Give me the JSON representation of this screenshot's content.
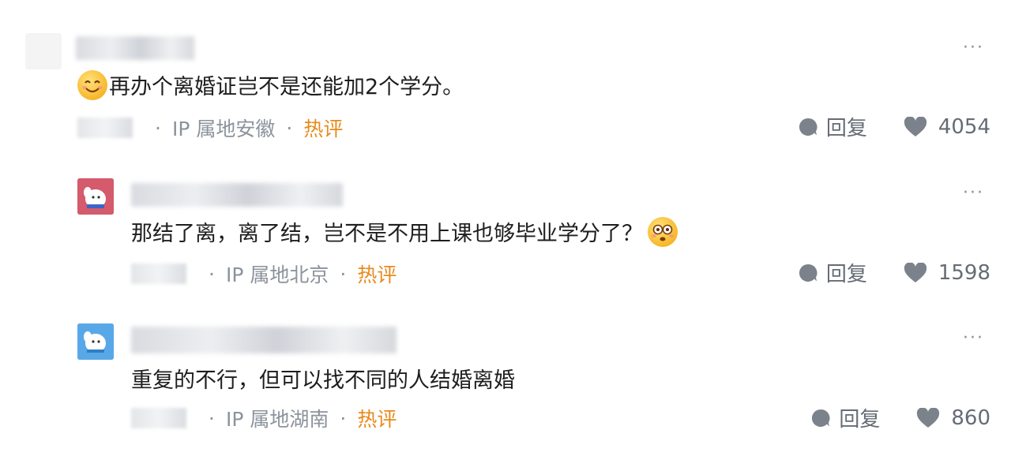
{
  "comments": [
    {
      "text": "再办个离婚证岂不是还能加2个学分。",
      "emoji_name": "smiling-face-icon",
      "ip": "IP 属地安徽",
      "tag": "热评",
      "reply_label": "回复",
      "likes": "4054"
    },
    {
      "text": "那结了离，离了结，岂不是不用上课也够毕业学分了？",
      "emoji_name": "flushed-face-icon",
      "ip": "IP 属地北京",
      "tag": "热评",
      "reply_label": "回复",
      "likes": "1598"
    },
    {
      "text": "重复的不行，但可以找不同的人结婚离婚",
      "ip": "IP 属地湖南",
      "tag": "热评",
      "reply_label": "回复",
      "likes": "860"
    }
  ],
  "colors": {
    "hot": "#e88a1c",
    "meta": "#8c939c",
    "icon": "#7c828b"
  }
}
